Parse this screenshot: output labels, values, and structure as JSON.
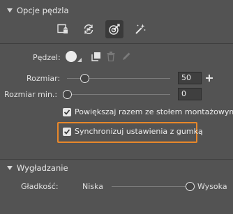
{
  "sections": {
    "brush_options": {
      "title": "Opcje pędzla"
    },
    "smoothing": {
      "title": "Wygładzanie"
    }
  },
  "modes": [
    {
      "icon": "image-lock-icon",
      "active": false
    },
    {
      "icon": "sync-settings-icon",
      "active": false
    },
    {
      "icon": "target-brush-icon",
      "active": true
    },
    {
      "icon": "magic-wand-icon",
      "active": false
    }
  ],
  "brush": {
    "label": "Pędzel:",
    "icons": [
      "brush-dot-icon",
      "brush-dropdown-icon",
      "copy-brush-icon",
      "delete-brush-icon",
      "edit-brush-icon"
    ]
  },
  "size": {
    "label": "Rozmiar:",
    "value": "50",
    "slider_fraction": 0.17
  },
  "min_size": {
    "label": "Rozmiar min.:",
    "value": "0",
    "slider_fraction": 0.0
  },
  "checkboxes": {
    "scale_with_artboard": {
      "label": "Powiększaj razem ze stołem montażowym",
      "checked": true
    },
    "sync_with_eraser": {
      "label": "Synchronizuj ustawienia z gumką",
      "checked": true
    }
  },
  "smoothness": {
    "label": "Gładkość:",
    "low": "Niska",
    "high": "Wysoka",
    "slider_fraction": 1.0
  },
  "colors": {
    "panel_bg": "#535353",
    "highlight_border": "#e8872a",
    "active_button_bg": "#3a3a3a"
  }
}
